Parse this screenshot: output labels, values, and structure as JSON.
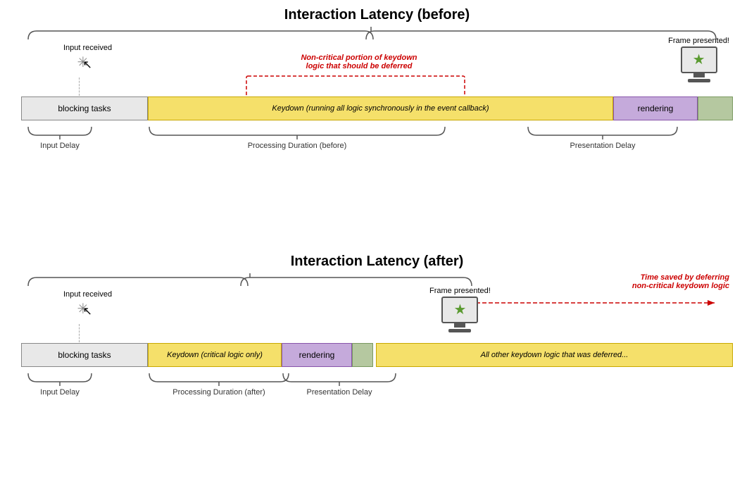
{
  "before": {
    "title": "Interaction Latency (before)",
    "input_received": "Input received",
    "frame_presented": "Frame presented!",
    "blocks": {
      "blocking": "blocking tasks",
      "keydown": "Keydown (running all logic synchronously in the event callback)",
      "rendering": "rendering"
    },
    "labels": {
      "input_delay": "Input Delay",
      "processing_duration": "Processing Duration (before)",
      "presentation_delay": "Presentation Delay"
    },
    "annotation": {
      "text_line1": "Non-critical portion of keydown",
      "text_line2": "logic that should be deferred"
    }
  },
  "after": {
    "title": "Interaction Latency (after)",
    "input_received": "Input received",
    "frame_presented": "Frame presented!",
    "blocks": {
      "blocking": "blocking tasks",
      "keydown": "Keydown (critical logic only)",
      "rendering": "rendering",
      "deferred": "All other keydown logic that was deferred..."
    },
    "labels": {
      "input_delay": "Input Delay",
      "processing_duration": "Processing Duration (after)",
      "presentation_delay": "Presentation Delay"
    },
    "time_saved": {
      "line1": "Time saved by deferring",
      "line2": "non-critical keydown logic"
    }
  }
}
